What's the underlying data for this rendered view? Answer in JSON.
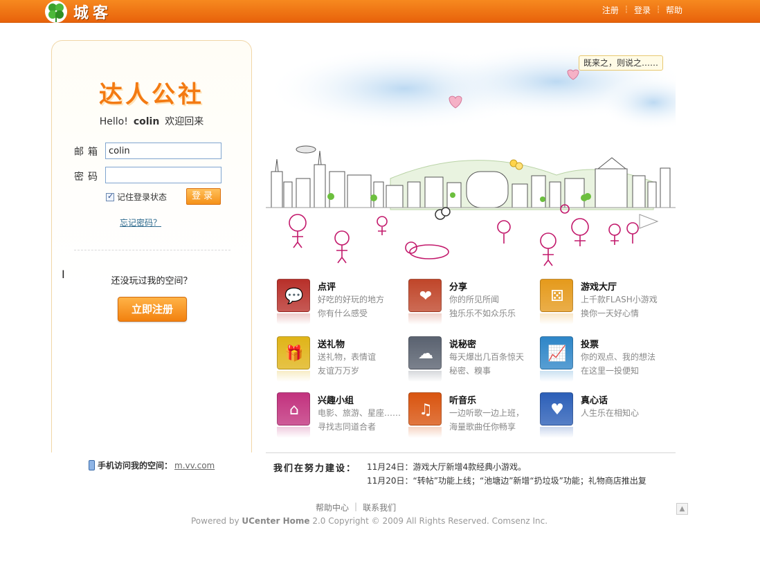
{
  "header": {
    "logo_text": "城客",
    "links": [
      "注册",
      "登录",
      "帮助"
    ]
  },
  "login": {
    "brand_title": "达人公社",
    "greeting_prefix": "Hello!",
    "username_display": "colin",
    "greeting_suffix": "欢迎回来",
    "email_label": "邮箱",
    "email_value": "colin",
    "password_label": "密码",
    "password_value": "",
    "remember_label": "记住登录状态",
    "login_button": "登录",
    "forgot_link": "忘记密码？",
    "not_played": "还没玩过我的空间？",
    "register_button": "立即注册",
    "mobile_label": "手机访问我的空间：",
    "mobile_url": "m.vv.com"
  },
  "hero": {
    "bubble_text": "既来之，则说之……"
  },
  "features": [
    {
      "title": "点评",
      "line1": "好吃的好玩的地方",
      "line2": "你有什么感受",
      "icon": "comment-icon",
      "color": "#b8302a"
    },
    {
      "title": "分享",
      "line1": "你的所见所闻",
      "line2": "独乐乐不如众乐乐",
      "icon": "share-icon",
      "color": "#c0462a"
    },
    {
      "title": "游戏大厅",
      "line1": "上千款FLASH小游戏",
      "line2": "换你一天好心情",
      "icon": "dice-icon",
      "color": "#e59a1c"
    },
    {
      "title": "送礼物",
      "line1": "送礼物，表情谊",
      "line2": "友谊万万岁",
      "icon": "gift-icon",
      "color": "#e0b418"
    },
    {
      "title": "说秘密",
      "line1": "每天爆出几百条惊天",
      "line2": "秘密、糗事",
      "icon": "secret-icon",
      "color": "#5a6270"
    },
    {
      "title": "投票",
      "line1": "你的观点、我的想法",
      "line2": "在这里一投便知",
      "icon": "vote-icon",
      "color": "#2e86c8"
    },
    {
      "title": "兴趣小组",
      "line1": "电影、旅游、星座……",
      "line2": "寻找志同道合者",
      "icon": "house-icon",
      "color": "#c2327e"
    },
    {
      "title": "听音乐",
      "line1": "一边听歌一边上班，",
      "line2": "海量歌曲任你畅享",
      "icon": "music-icon",
      "color": "#d9540f"
    },
    {
      "title": "真心话",
      "line1": "人生乐在相知心",
      "line2": "",
      "icon": "heart-icon",
      "color": "#2c5fb8"
    }
  ],
  "news": {
    "title": "我们在努力建设：",
    "items": [
      "11月24日：游戏大厅新增4款经典小游戏。",
      "11月20日：“转帖”功能上线；“池塘边”新增“扔垃圾”功能；礼物商店推出复"
    ]
  },
  "footer": {
    "links": [
      "帮助中心",
      "联系我们"
    ],
    "copyright_prefix": "Powered by ",
    "copyright_brand": "UCenter Home",
    "copyright_suffix": " 2.0 Copyright © 2009 All Rights Reserved. Comsenz Inc."
  }
}
